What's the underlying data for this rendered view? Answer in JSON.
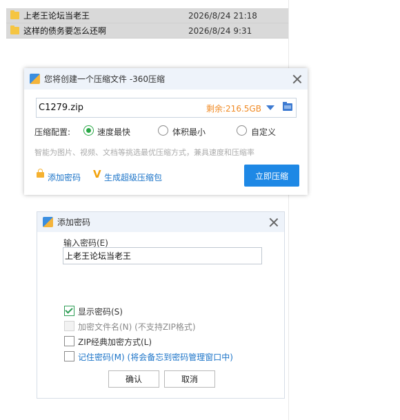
{
  "file_list": [
    {
      "name": "上老王论坛当老王",
      "date": "2026/8/24 21:18"
    },
    {
      "name": "这样的债务要怎么还啊",
      "date": "2026/8/24 9:31"
    }
  ],
  "compress_dialog": {
    "title": "您将创建一个压缩文件 -360压缩",
    "archive_name": "C1279.zip",
    "free_space": "剩余:216.5GB",
    "config_label": "压缩配置:",
    "options": [
      {
        "label": "速度最快",
        "selected": true
      },
      {
        "label": "体积最小",
        "selected": false
      },
      {
        "label": "自定义",
        "selected": false
      }
    ],
    "hint": "智能为图片、视频、文档等挑选最优压缩方式，兼具速度和压缩率",
    "add_password_link": "添加密码",
    "super_compress_link": "生成超级压缩包",
    "compress_button": "立即压缩",
    "accent_color": "#1e88e5",
    "free_space_color": "#f08a24"
  },
  "password_dialog": {
    "title": "添加密码",
    "input_label": "输入密码(E)",
    "password_value": "上老王论坛当老王",
    "checkboxes": [
      {
        "label": "显示密码(S)",
        "checked": true,
        "enabled": true
      },
      {
        "label": "加密文件名(N) (不支持ZIP格式)",
        "checked": false,
        "enabled": false
      },
      {
        "label": "ZIP经典加密方式(L)",
        "checked": false,
        "enabled": true
      },
      {
        "label": "记住密码(M) (将会备忘到密码管理窗口中)",
        "checked": false,
        "enabled": true
      }
    ],
    "ok_button": "确认",
    "cancel_button": "取消"
  },
  "icons": {
    "folder": "folder-icon",
    "app": "360-compress-app-icon",
    "close": "close-icon",
    "dropdown": "chevron-down-icon",
    "browse": "folder-browse-icon",
    "lock": "lock-icon",
    "v": "v-badge-icon"
  }
}
